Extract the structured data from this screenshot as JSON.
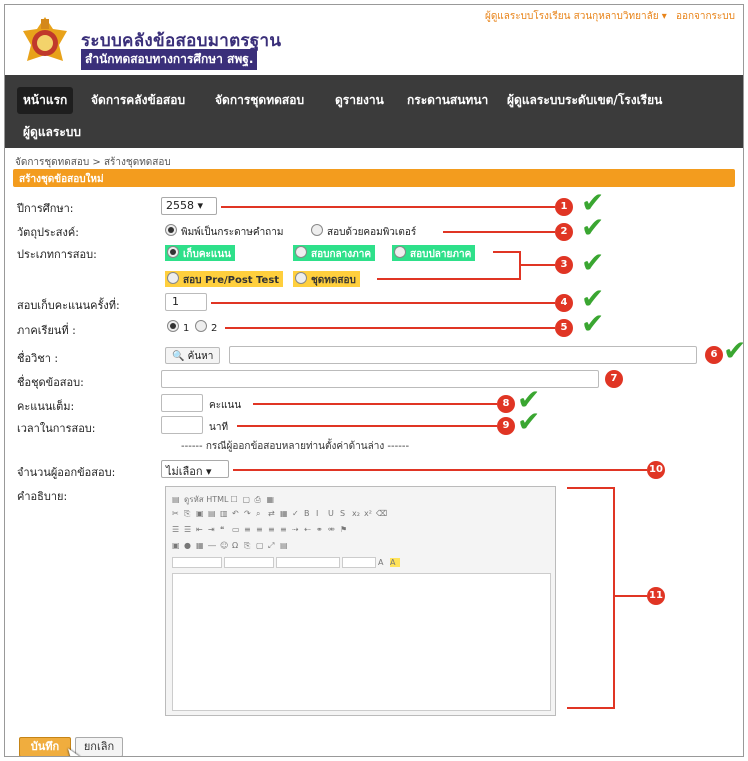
{
  "header": {
    "title": "ระบบคลังข้อสอบมาตรฐาน",
    "subtitle": "สำนักทดสอบทางการศึกษา สพฐ.",
    "user": "ผู้ดูแลระบบโรงเรียน สวนกุหลาบวิทยาลัย ▾",
    "logout": "ออกจากระบบ"
  },
  "nav": {
    "items": [
      {
        "label": "หน้าแรก"
      },
      {
        "label": "จัดการคลังข้อสอบ"
      },
      {
        "label": "จัดการชุดทดสอบ"
      },
      {
        "label": "ดูรายงาน"
      },
      {
        "label": "กระดานสนทนา"
      },
      {
        "label": "ผู้ดูแลระบบระดับเขต/โรงเรียน"
      },
      {
        "label": "ผู้ดูแลระบบ"
      }
    ]
  },
  "breadcrumb": "จัดการชุดทดสอบ > สร้างชุดทดสอบ",
  "panel_title": "สร้างชุดข้อสอบใหม่",
  "form": {
    "year_label": "ปีการศึกษา:",
    "year_value": "2558 ▾",
    "purpose_label": "วัตถุประสงค์:",
    "purpose_opt1": "พิมพ์เป็นกระดาษคำถาม",
    "purpose_opt2": "สอบด้วยคอมพิวเตอร์",
    "type_label": "ประเภทการสอบ:",
    "type_opt1": "เก็บคะแนน",
    "type_opt2": "สอบกลางภาค",
    "type_opt3": "สอบปลายภาค",
    "type_opt4": "สอบ Pre/Post Test",
    "type_opt5": "ชุดทดสอบ",
    "round_label": "สอบเก็บคะแนนครั้งที่:",
    "round_value": "1",
    "term_label": "ภาคเรียนที่ :",
    "term_opt1": "1",
    "term_opt2": "2",
    "subject_label": "ชื่อวิชา :",
    "search_button": "ค้นหา",
    "setname_label": "ชื่อชุดข้อสอบ:",
    "fullscore_label": "คะแนนเต็ม:",
    "fullscore_unit": "คะแนน",
    "time_label": "เวลาในการสอบ:",
    "time_unit": "นาที",
    "note": "------ กรณีผู้ออกข้อสอบหลายท่านตั้งค่าด้านล่าง ------",
    "authors_label": "จำนวนผู้ออกข้อสอบ:",
    "authors_value": "ไม่เลือก ▾",
    "desc_label": "คำอธิบาย:"
  },
  "editor": {
    "source_button": "ดูรหัส HTML"
  },
  "badges": [
    "1",
    "2",
    "3",
    "4",
    "5",
    "6",
    "7",
    "8",
    "9",
    "10",
    "11"
  ],
  "buttons": {
    "save": "บันทึก",
    "cancel": "ยกเลิก"
  },
  "colors": {
    "navbar": "#3b3b3b",
    "accent_orange": "#f39c1e",
    "annotation_red": "#e03524",
    "check_green": "#3aa631"
  }
}
